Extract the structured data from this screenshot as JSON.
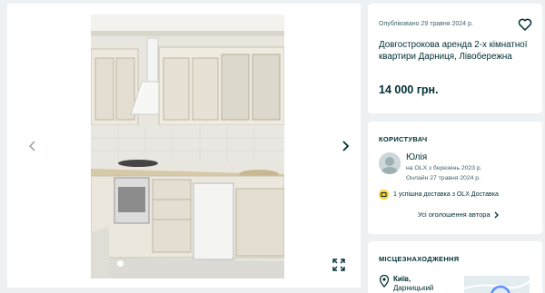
{
  "gallery": {
    "photo_alt": "Kitchen photo",
    "dot_count": 1
  },
  "ad": {
    "posted": "Опубліковано 29 травня 2024 р.",
    "title": "Довгострокова аренда 2-х кімнатної квартири Дарниця, Лівобережна",
    "price": "14 000 грн."
  },
  "user": {
    "section_title": "КОРИСТУВАЧ",
    "name": "Юлія",
    "since": "на OLX з березень 2023 р.",
    "online": "Онлайн 27 травня 2024 р.",
    "delivery": "1 успішна доставка з OLX Доставка",
    "all_ads": "Усі оголошення автора"
  },
  "location": {
    "section_title": "МІСЦЕЗНАХОДЖЕННЯ",
    "city": "Київ,",
    "district": "Дарницький"
  },
  "colors": {
    "page_bg": "#eef1f4",
    "text": "#002f34",
    "muted": "#406367",
    "delivery_badge": "#ffce32"
  },
  "icons": {
    "prev": "chevron-left-icon",
    "next": "chevron-right-icon",
    "fullscreen": "expand-icon",
    "favorite": "heart-icon",
    "delivery": "delivery-icon",
    "location": "map-pin-icon",
    "more": "chevron-right-icon"
  }
}
